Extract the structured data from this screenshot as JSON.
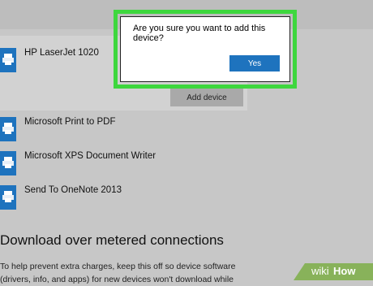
{
  "devices": [
    {
      "name": "HP LaserJet 1020"
    },
    {
      "name": "Microsoft Print to PDF"
    },
    {
      "name": "Microsoft XPS Document Writer"
    },
    {
      "name": "Send To OneNote 2013"
    }
  ],
  "add_device_label": "Add device",
  "dialog": {
    "question": "Are you sure you want to add this device?",
    "yes_label": "Yes"
  },
  "metered": {
    "title": "Download over metered connections",
    "body_lines": [
      "To help prevent extra charges, keep this off so device software",
      "(drivers, info, and apps) for new devices won't download while"
    ]
  },
  "watermark": {
    "part1": "wiki",
    "part2": "How"
  },
  "colors": {
    "accent": "#1e73be",
    "highlight": "#3ed73e",
    "watermark": "#88b25a"
  }
}
